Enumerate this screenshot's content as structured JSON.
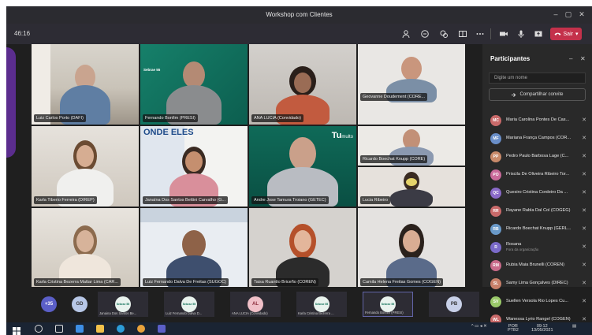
{
  "window": {
    "title": "Workshop com Clientes"
  },
  "toolbar": {
    "timer": "46:16",
    "leave_label": "Sair"
  },
  "tiles": [
    {
      "name": "Luiz Carlos Porto (DAFI)"
    },
    {
      "name": "Fernando Bonfim (PRESI)",
      "badge": "Sebrae 55"
    },
    {
      "name": "ANA LUCIA (Convidado)"
    },
    {
      "name": "Geovanne Doudement (CORE..."
    },
    {
      "name": "Karla Tiberio Ferreira (DIREP)"
    },
    {
      "name": "Janaína Dos Santos Bettini Carvalho (G..."
    },
    {
      "name": "Andre Jose Tamura Troiano (GETEC)"
    },
    {
      "name": "Ricardo Boechat Knupp (CORE)"
    },
    {
      "name": "Lucia Ribeiro"
    },
    {
      "name": "Karla Cristina Bezerra Mattar Lima (CAR..."
    },
    {
      "name": "Luiz Fernando Dalva De Freitas (SUGOC)"
    },
    {
      "name": "Taisa Ruantto Briceño (COREN)"
    },
    {
      "name": "Camila Helena Freitas Gomes (COGEN)"
    }
  ],
  "wall_text": {
    "banner": "ONDE ELES",
    "logo": "Tu",
    "logo2": "multo"
  },
  "panel": {
    "title": "Participantes",
    "search_placeholder": "Digite um nome",
    "share_label": "Compartilhar convite",
    "participants": [
      {
        "name": "Maria Carolina Pontes De Cas...",
        "color": "#c96a6a",
        "initials": "MC"
      },
      {
        "name": "Mariana França Campos (COR...",
        "color": "#6a8fc9",
        "initials": "MF"
      },
      {
        "name": "Pedro Paulo Barbosa Lage (C...",
        "color": "#c98a6a",
        "initials": "PP"
      },
      {
        "name": "Priscila De Oliveira Ribeiro Tor...",
        "color": "#c96a9a",
        "initials": "PO"
      },
      {
        "name": "Quesiro Cristina Cordeiro Da ...",
        "color": "#8a6ac9",
        "initials": "QC"
      },
      {
        "name": "Rayane Rabla Dal Col (COGEG)",
        "color": "#c96a6a",
        "initials": "RR"
      },
      {
        "name": "Ricardo Boechat Knupp (GERL...",
        "color": "#6a9ac9",
        "initials": "RB"
      },
      {
        "name": "Rosana",
        "sub": "Fora da organização",
        "color": "#7a6ac9",
        "initials": "R"
      },
      {
        "name": "Rubia Maia Brunelli (COREN)",
        "color": "#c96a8a",
        "initials": "RM"
      },
      {
        "name": "Samy Lima Gonçalves (DIREC)",
        "color": "#c9806a",
        "initials": "SL"
      },
      {
        "name": "Suellen Versola Rio Lopes Cu...",
        "color": "#9ac96a",
        "initials": "SV"
      },
      {
        "name": "Wanessa Lyrio Rangel (COGEN)",
        "color": "#c96a6a",
        "initials": "WL"
      }
    ]
  },
  "thumbs": [
    {
      "label": "+35",
      "kind": "more"
    },
    {
      "label": "GD",
      "kind": "avatar",
      "color": "#b7c7e6"
    },
    {
      "caption": "Janaina Dos Santos Be...",
      "kind": "logo",
      "text": "Sebrae 55"
    },
    {
      "caption": "Luiz Fernando Dalva D...",
      "kind": "logo",
      "text": "Sebrae 55"
    },
    {
      "caption": "ANA LUCIA (Convidado)",
      "kind": "avatar",
      "label": "AL",
      "color": "#f0c0c8"
    },
    {
      "caption": "Karla Cristina Bezerra ...",
      "kind": "logo",
      "text": "Sebrae 55"
    },
    {
      "caption": "Fernando Bonfim (PRESI)",
      "kind": "logo",
      "text": "Sebrae 55"
    },
    {
      "label": "PB",
      "kind": "avatar",
      "color": "#c8d0e8"
    }
  ],
  "taskbar": {
    "lang": "POR",
    "lang2": "PTB2",
    "time": "09:12",
    "date": "13/05/2021"
  },
  "colors": {
    "accent": "#c4314b",
    "panel_bg": "#292929",
    "purple": "#5b2d8e"
  }
}
